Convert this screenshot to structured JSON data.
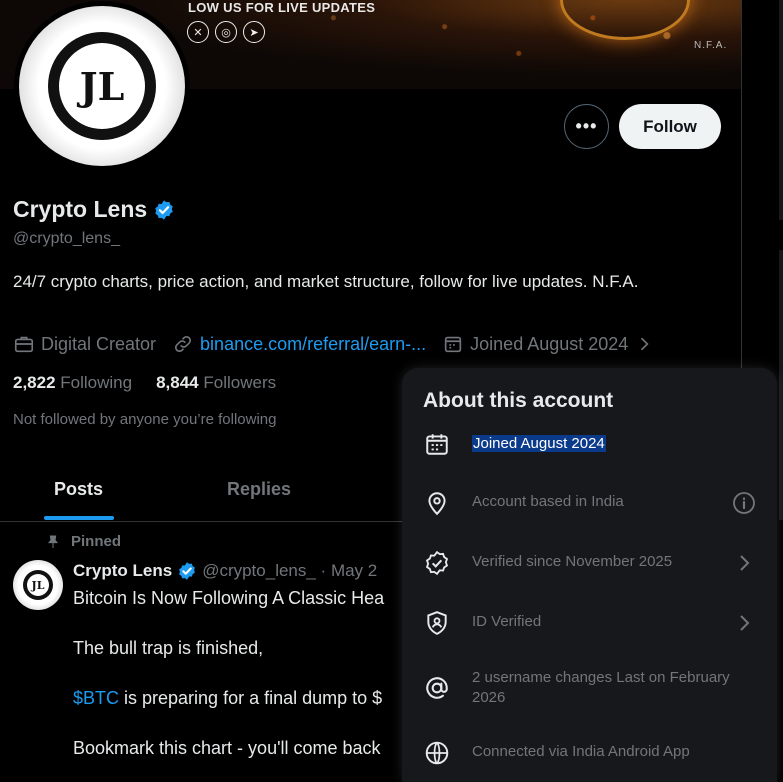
{
  "banner": {
    "headline": "LOW US FOR LIVE UPDATES",
    "disclaimer": "N.F.A.",
    "socials": [
      "x-icon",
      "instagram-icon",
      "telegram-icon"
    ]
  },
  "profile": {
    "avatar_monogram": "JL",
    "name": "Crypto Lens",
    "handle": "@crypto_lens_",
    "bio": "24/7 crypto charts, price action, and market structure, follow for live updates. N.F.A.",
    "category": "Digital Creator",
    "website": "binance.com/referral/earn-...",
    "joined": "Joined August 2024",
    "following_count": "2,822",
    "following_label": "Following",
    "followers_count": "8,844",
    "followers_label": "Followers",
    "not_followed": "Not followed by anyone you’re following"
  },
  "actions": {
    "more_label": "•••",
    "follow_label": "Follow"
  },
  "tabs": [
    {
      "label": "Posts",
      "active": true
    },
    {
      "label": "Replies",
      "active": false
    }
  ],
  "post": {
    "pinned_label": "Pinned",
    "author": "Crypto Lens",
    "handle_date": "@crypto_lens_ · May 2",
    "line1": "Bitcoin Is Now Following A Classic Hea",
    "line2": "The bull trap is finished,",
    "cashtag": "$BTC",
    "line3_rest": " is preparing for a final dump to $",
    "line4": "Bookmark this chart - you'll come back"
  },
  "about_popup": {
    "title": "About this account",
    "rows": [
      {
        "icon": "calendar-icon",
        "text": "Joined August 2024",
        "selected": true
      },
      {
        "icon": "location-pin-icon",
        "text": "Account based in India",
        "trailing": "info-icon"
      },
      {
        "icon": "verified-badge-icon",
        "text": "Verified since November 2025",
        "trailing": "chevron-right-icon"
      },
      {
        "icon": "id-shield-icon",
        "text": "ID Verified",
        "trailing": "chevron-right-icon"
      },
      {
        "icon": "at-sign-icon",
        "text": "2 username changes Last on February 2026"
      },
      {
        "icon": "globe-icon",
        "text": "Connected via India Android App"
      }
    ]
  },
  "colors": {
    "background": "#000000",
    "accent": "#1d9bf0",
    "muted": "#71767b",
    "popup_bg": "#16181c",
    "selection": "#0b3a8a"
  }
}
